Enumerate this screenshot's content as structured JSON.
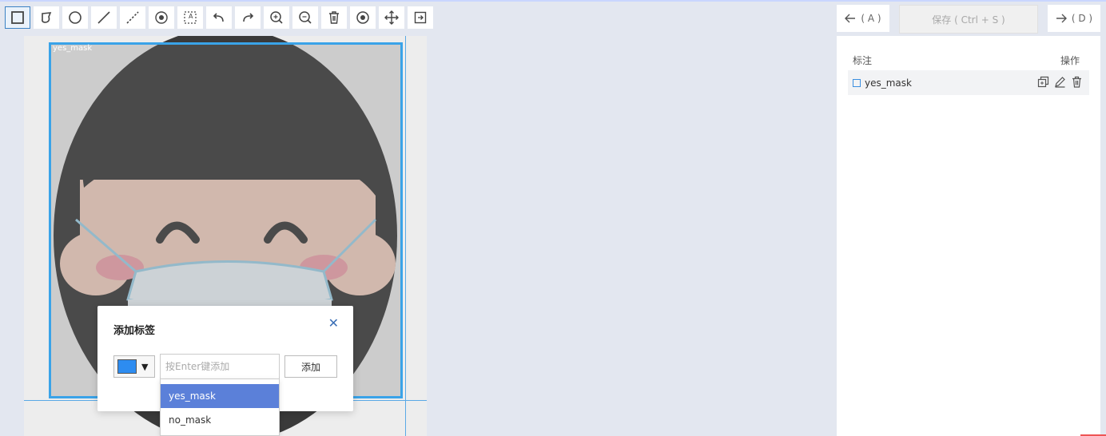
{
  "toolbar": {
    "tools": [
      "rectangle-icon",
      "polygon-icon",
      "circle-icon",
      "line-icon",
      "dashed-line-icon",
      "point-icon",
      "text-box-icon",
      "undo-icon",
      "redo-icon",
      "zoom-in-icon",
      "zoom-out-icon",
      "delete-icon",
      "visibility-icon",
      "move-icon",
      "fit-icon"
    ]
  },
  "nav": {
    "prev_label": "( A )",
    "save_label": "保存 ( Ctrl + S )",
    "next_label": "( D )"
  },
  "canvas": {
    "bbox_label": "yes_mask",
    "bbox_color": "#3aa3e8"
  },
  "panel": {
    "col_label": "标注",
    "col_actions": "操作",
    "annotations": [
      {
        "label": "yes_mask",
        "color": "#3b8fe0"
      }
    ]
  },
  "dialog": {
    "title": "添加标签",
    "close_glyph": "✕",
    "color": "#2d8cf0",
    "input_placeholder": "按Enter键添加",
    "input_value": "",
    "add_label": "添加",
    "options": [
      "yes_mask",
      "no_mask"
    ],
    "selected_option": "yes_mask"
  }
}
